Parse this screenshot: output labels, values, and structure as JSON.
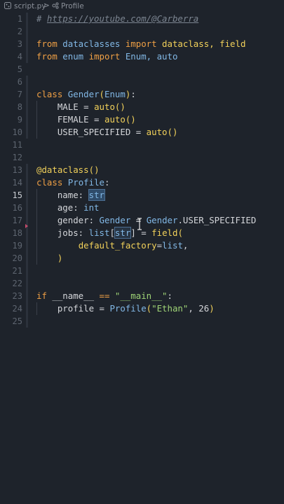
{
  "breadcrumb": {
    "file": "script.py",
    "separator": ">",
    "symbol": "Profile"
  },
  "lines": [
    {
      "n": "1"
    },
    {
      "n": "2"
    },
    {
      "n": "3"
    },
    {
      "n": "4"
    },
    {
      "n": "5"
    },
    {
      "n": "6"
    },
    {
      "n": "7"
    },
    {
      "n": "8"
    },
    {
      "n": "9"
    },
    {
      "n": "10"
    },
    {
      "n": "11"
    },
    {
      "n": "12"
    },
    {
      "n": "13"
    },
    {
      "n": "14"
    },
    {
      "n": "15"
    },
    {
      "n": "16"
    },
    {
      "n": "17"
    },
    {
      "n": "18"
    },
    {
      "n": "19"
    },
    {
      "n": "20"
    },
    {
      "n": "21"
    },
    {
      "n": "22"
    },
    {
      "n": "23"
    },
    {
      "n": "24"
    },
    {
      "n": "25"
    }
  ],
  "code": {
    "l1": {
      "hash": "# ",
      "url": "https://youtube.com/@Carberra"
    },
    "l3": {
      "kw1": "from",
      "mod": " dataclasses ",
      "kw2": "import",
      "names": " dataclass, field"
    },
    "l4": {
      "kw1": "from",
      "mod": " enum ",
      "kw2": "import",
      "names": " Enum, auto"
    },
    "l7": {
      "kw": "class",
      "name": " Gender",
      "p1": "(",
      "base": "Enum",
      "p2": ")",
      "colon": ":"
    },
    "l8": {
      "name": "    MALE = ",
      "fn": "auto",
      "p": "()"
    },
    "l9": {
      "name": "    FEMALE = ",
      "fn": "auto",
      "p": "()"
    },
    "l10": {
      "name": "    USER_SPECIFIED = ",
      "fn": "auto",
      "p": "()"
    },
    "l13": {
      "dec": "@dataclass",
      "p": "()"
    },
    "l14": {
      "kw": "class",
      "name": " Profile",
      "colon": ":"
    },
    "l15": {
      "attr": "    name: ",
      "type": "str"
    },
    "l16": {
      "attr": "    age: ",
      "type": "int"
    },
    "l17": {
      "attr": "    gender: ",
      "type": "Gender",
      "eq": " = ",
      "cls": "Gender",
      "rest": ".USER_SPECIFIED"
    },
    "l18": {
      "attr": "    jobs: ",
      "type": "list",
      "b1": "[",
      "inner": "str",
      "b2": "]",
      "eq": " = ",
      "fn": "field",
      "p": "("
    },
    "l19": {
      "indent": "        ",
      "kwarg": "default_factory",
      "eq": "=",
      "val": "list",
      "comma": ","
    },
    "l20": {
      "indent": "    ",
      "p": ")"
    },
    "l23": {
      "kw": "if",
      "mid": " __name__ ",
      "op": "==",
      "sp": " ",
      "str": "\"__main__\"",
      "colon": ":"
    },
    "l24": {
      "lhs": "    profile = ",
      "cls": "Profile",
      "p1": "(",
      "str": "\"Ethan\"",
      "rest": ", 26",
      "p2": ")"
    }
  },
  "colors": {
    "background": "#1e232b",
    "keyword": "#f0a045",
    "class": "#82b8e6",
    "function": "#f2d15a",
    "string": "#9fd476",
    "comment": "#7c8591"
  },
  "icons": {
    "file_icon": "python-file-icon",
    "symbol_icon": "class-symbol-icon",
    "cursor": "text-cursor-icon"
  }
}
